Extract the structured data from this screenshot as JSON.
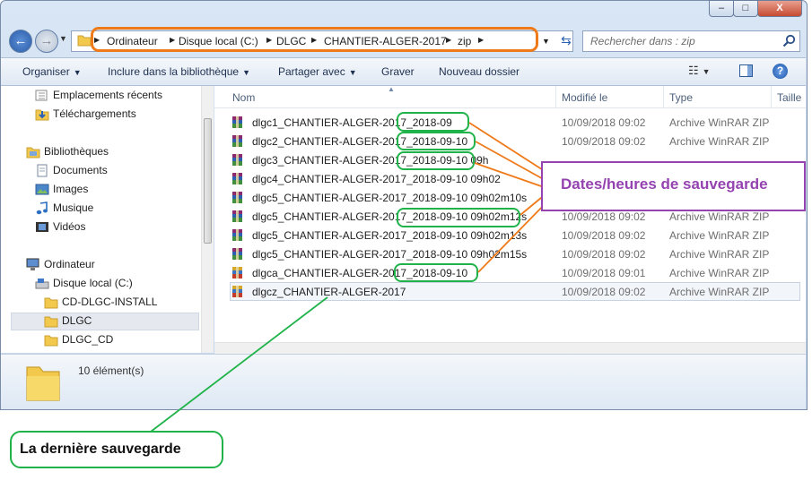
{
  "titlebar": {
    "minimize": "–",
    "maximize": "□",
    "close": "X"
  },
  "address": {
    "crumbs": [
      "Ordinateur",
      "Disque local (C:)",
      "DLGC",
      "CHANTIER-ALGER-2017",
      "zip"
    ]
  },
  "search": {
    "placeholder": "Rechercher dans : zip"
  },
  "toolbar": {
    "organize": "Organiser",
    "include": "Inclure dans la bibliothèque",
    "share": "Partager avec",
    "burn": "Graver",
    "new_folder": "Nouveau dossier",
    "help": "?"
  },
  "nav": {
    "recent": "Emplacements récents",
    "downloads": "Téléchargements",
    "libraries": "Bibliothèques",
    "documents": "Documents",
    "images": "Images",
    "music": "Musique",
    "videos": "Vidéos",
    "computer": "Ordinateur",
    "local_disk": "Disque local (C:)",
    "cd_install": "CD-DLGC-INSTALL",
    "dlgc": "DLGC",
    "dlgc_cd": "DLGC_CD"
  },
  "columns": {
    "name": "Nom",
    "modified": "Modifié le",
    "type": "Type",
    "size": "Taille"
  },
  "files": [
    {
      "name": "dlgc1_CHANTIER-ALGER-2017_2018-09",
      "date": "10/09/2018 09:02",
      "type": "Archive WinRAR ZIP"
    },
    {
      "name": "dlgc2_CHANTIER-ALGER-2017_2018-09-10",
      "date": "10/09/2018 09:02",
      "type": "Archive WinRAR ZIP"
    },
    {
      "name": "dlgc3_CHANTIER-ALGER-2017_2018-09-10 09h",
      "date": "",
      "type": ""
    },
    {
      "name": "dlgc4_CHANTIER-ALGER-2017_2018-09-10 09h02",
      "date": "",
      "type": ""
    },
    {
      "name": "dlgc5_CHANTIER-ALGER-2017_2018-09-10 09h02m10s",
      "date": "",
      "type": ""
    },
    {
      "name": "dlgc5_CHANTIER-ALGER-2017_2018-09-10 09h02m12s",
      "date": "10/09/2018 09:02",
      "type": "Archive WinRAR ZIP"
    },
    {
      "name": "dlgc5_CHANTIER-ALGER-2017_2018-09-10 09h02m13s",
      "date": "10/09/2018 09:02",
      "type": "Archive WinRAR ZIP"
    },
    {
      "name": "dlgc5_CHANTIER-ALGER-2017_2018-09-10 09h02m15s",
      "date": "10/09/2018 09:02",
      "type": "Archive WinRAR ZIP"
    },
    {
      "name": "dlgca_CHANTIER-ALGER-2017_2018-09-10",
      "date": "10/09/2018 09:01",
      "type": "Archive WinRAR ZIP"
    },
    {
      "name": "dlgcz_CHANTIER-ALGER-2017",
      "date": "10/09/2018 09:02",
      "type": "Archive WinRAR ZIP"
    }
  ],
  "details": {
    "count": "10 élément(s)"
  },
  "annotations": {
    "dates_label": "Dates/heures de sauvegarde",
    "last_label": "La dernière sauvegarde",
    "colors": {
      "orange": "#ef7a1a",
      "green": "#20b34a",
      "purple": "#9443b0"
    }
  }
}
